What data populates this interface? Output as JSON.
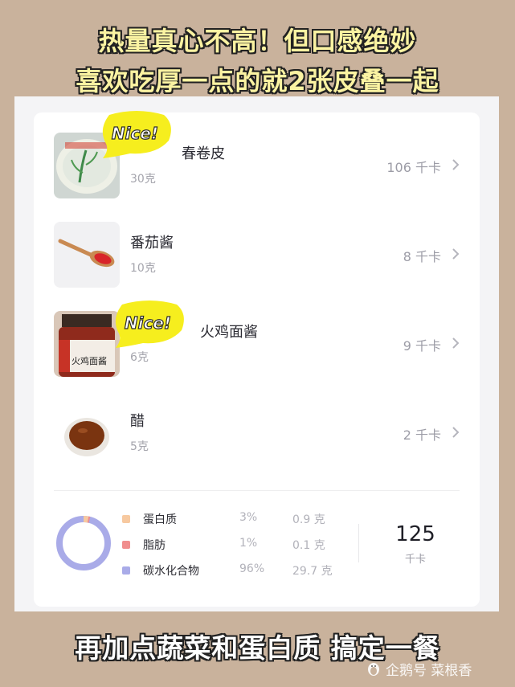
{
  "headline": {
    "line1": "热量真心不高！但口感绝妙",
    "line2": "喜欢吃厚一点的就2张皮叠一起"
  },
  "foods": [
    {
      "name": "春卷皮",
      "weight": "30克",
      "kcal": "106 千卡",
      "sticker": "Nice!"
    },
    {
      "name": "番茄酱",
      "weight": "10克",
      "kcal": "8 千卡"
    },
    {
      "name": "火鸡面酱",
      "weight": "6克",
      "kcal": "9 千卡",
      "sticker": "Nice!"
    },
    {
      "name": "醋",
      "weight": "5克",
      "kcal": "2 千卡"
    }
  ],
  "summary": {
    "macros": [
      {
        "label": "蛋白质",
        "percent": "3%",
        "grams": "0.9 克",
        "color": "#f7c9a0"
      },
      {
        "label": "脂肪",
        "percent": "1%",
        "grams": "0.1 克",
        "color": "#f08d8d"
      },
      {
        "label": "碳水化合物",
        "percent": "96%",
        "grams": "29.7 克",
        "color": "#a9abe8"
      }
    ],
    "total": "125",
    "unit": "千卡"
  },
  "footer_caption": "再加点蔬菜和蛋白质 搞定一餐",
  "watermark": "企鹅号 菜根香",
  "colors": {
    "background": "#c9b29c",
    "headline": "#fbf3a2",
    "sticker": "#f6ee1e"
  }
}
